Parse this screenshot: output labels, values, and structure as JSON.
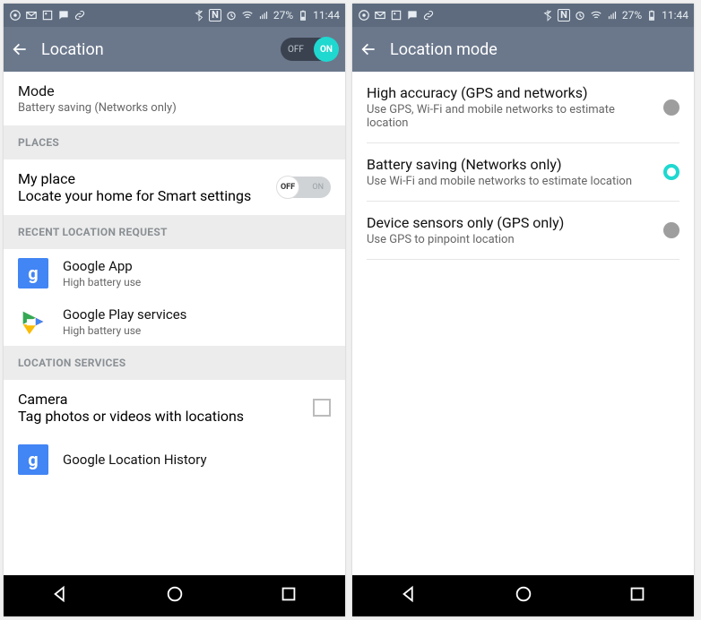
{
  "status": {
    "battery_pct": "27%",
    "time": "11:44"
  },
  "left": {
    "title": "Location",
    "toggle": {
      "off": "OFF",
      "on": "ON"
    },
    "mode": {
      "title": "Mode",
      "sub": "Battery saving (Networks only)"
    },
    "sec_places": "PLACES",
    "myplace": {
      "title": "My place",
      "sub": "Locate your home for Smart settings",
      "off": "OFF",
      "on": "ON"
    },
    "sec_recent": "RECENT LOCATION REQUEST",
    "app1": {
      "title": "Google App",
      "sub": "High battery use"
    },
    "app2": {
      "title": "Google Play services",
      "sub": "High battery use"
    },
    "sec_services": "LOCATION SERVICES",
    "camera": {
      "title": "Camera",
      "sub": "Tag photos or videos with locations"
    },
    "history": {
      "title": "Google Location History"
    },
    "g": "g"
  },
  "right": {
    "title": "Location mode",
    "opt1": {
      "title": "High accuracy (GPS and networks)",
      "sub": "Use GPS, Wi-Fi and mobile networks to estimate location"
    },
    "opt2": {
      "title": "Battery saving (Networks only)",
      "sub": "Use Wi-Fi and mobile networks to estimate location"
    },
    "opt3": {
      "title": "Device sensors only (GPS only)",
      "sub": "Use GPS to pinpoint location"
    }
  }
}
